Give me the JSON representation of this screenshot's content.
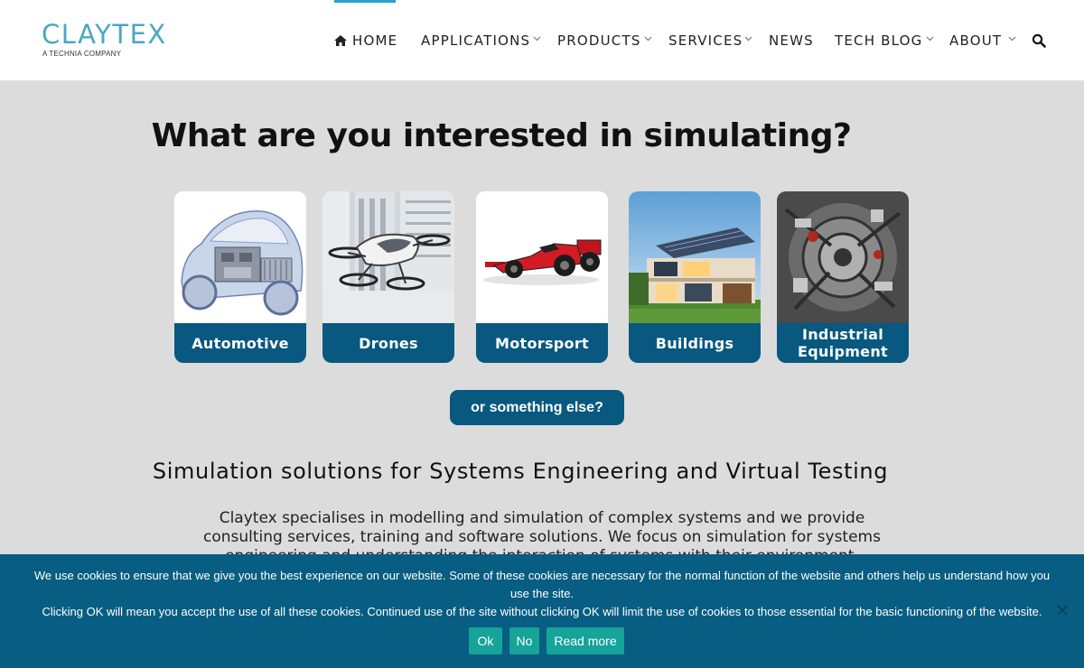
{
  "brand": {
    "name": "CLAYTEX",
    "tagline": "A TECHNIA COMPANY",
    "color": "#4aa7c2"
  },
  "nav": {
    "home": "HOME",
    "applications": "APPLICATIONS",
    "products": "PRODUCTS",
    "services": "SERVICES",
    "news": "NEWS",
    "tech_blog": "TECH BLOG",
    "about": "ABOUT",
    "home_icon": "home-icon",
    "search_icon": "search-icon",
    "chevron_icon": "chevron-down-icon"
  },
  "hero": {
    "title": "What are you interested in simulating?",
    "cards": [
      {
        "label": "Automotive"
      },
      {
        "label": "Drones"
      },
      {
        "label": "Motorsport"
      },
      {
        "label": "Buildings"
      },
      {
        "label": "Industrial Equipment"
      }
    ],
    "else_button": "or something else?"
  },
  "section": {
    "title": "Simulation solutions for Systems Engineering and Virtual Testing",
    "intro": "Claytex specialises in modelling and simulation of complex systems and we provide consulting services, training and software solutions. We focus on simulation for systems engineering and understanding the interaction of systems with their environment."
  },
  "cookie": {
    "line1": "We use cookies to ensure that we give you the best experience on our website. Some of these cookies are necessary for the normal function of the website and others help us understand how you use the site.",
    "line2": "Clicking OK will mean you accept the use of all these cookies. Continued use of the site without clicking OK will limit the use of cookies to those essential for the basic functioning of the website.",
    "ok": "Ok",
    "no": "No",
    "read_more": "Read more",
    "close_icon": "close-icon"
  },
  "colors": {
    "accent": "#08587f",
    "button_teal": "#16a39a",
    "active_bar": "#2aa1c6",
    "page_bg": "#dcdcdc"
  }
}
